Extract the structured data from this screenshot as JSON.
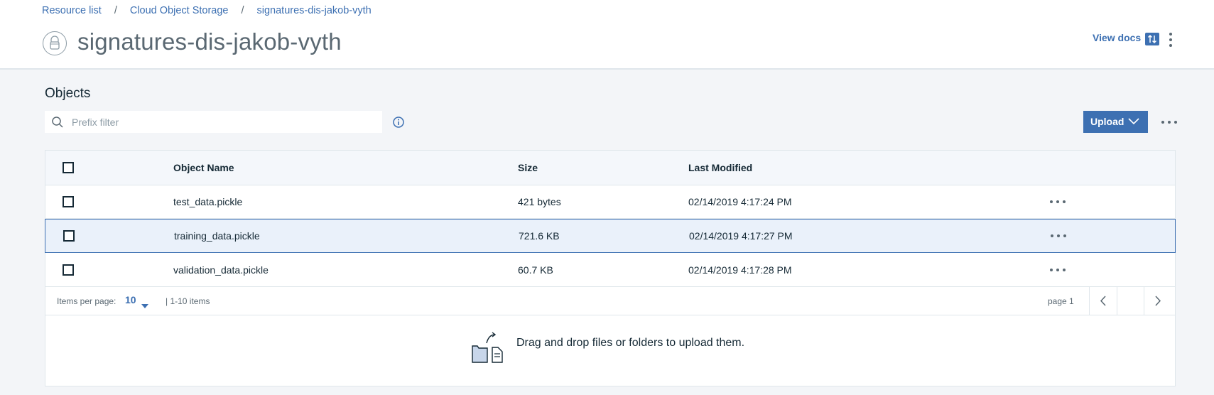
{
  "breadcrumb": {
    "items": [
      "Resource list",
      "Cloud Object Storage",
      "signatures-dis-jakob-vyth"
    ],
    "separator": "/"
  },
  "header": {
    "title": "signatures-dis-jakob-vyth",
    "view_docs_label": "View docs"
  },
  "objects": {
    "section_title": "Objects",
    "filter": {
      "placeholder": "Prefix filter",
      "value": ""
    },
    "upload_label": "Upload"
  },
  "table": {
    "columns": [
      "Object Name",
      "Size",
      "Last Modified"
    ],
    "rows": [
      {
        "name": "test_data.pickle",
        "size": "421 bytes",
        "modified": "02/14/2019 4:17:24 PM",
        "selected": false
      },
      {
        "name": "training_data.pickle",
        "size": "721.6 KB",
        "modified": "02/14/2019 4:17:27 PM",
        "selected": true
      },
      {
        "name": "validation_data.pickle",
        "size": "60.7 KB",
        "modified": "02/14/2019 4:17:28 PM",
        "selected": false
      }
    ]
  },
  "pagination": {
    "items_per_page_label": "Items per page:",
    "items_per_page_value": "10",
    "range_text": "|  1-10 items",
    "page_text": "page 1"
  },
  "dropzone": {
    "text": "Drag and drop files or folders to upload them."
  },
  "colors": {
    "accent": "#3d70b2",
    "text": "#152935",
    "muted": "#5a6872",
    "background": "#f3f5f8",
    "selected_row": "#eaf1fa"
  },
  "icons": {
    "bucket": "bucket-icon",
    "search": "search-icon",
    "info": "info-icon",
    "upload_caret": "chevron-down-icon",
    "overflow": "overflow-menu-icon",
    "docs": "sort-arrows-icon",
    "dropzone": "upload-files-icon"
  }
}
